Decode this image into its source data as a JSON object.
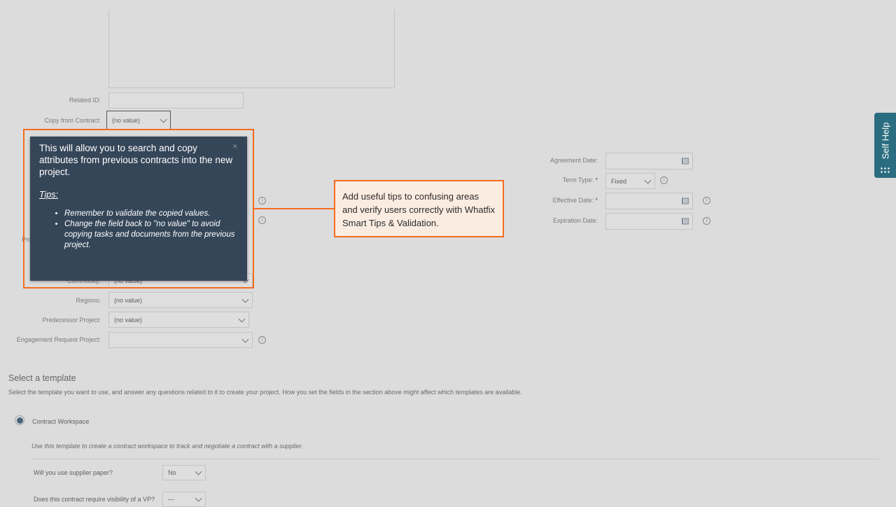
{
  "form": {
    "related_id_label": "Related ID:",
    "copy_label": "Copy from Contract:",
    "copy_value": "(no value)",
    "proj_label_partial": "Pro",
    "commodity_label": "Commodity:",
    "commodity_value": "(no value)",
    "regions_label": "Regions:",
    "regions_value": "(no value)",
    "predecessor_label": "Predecessor Project:",
    "predecessor_value": "(no value)",
    "engagement_label": "Engagement Request Project:",
    "engagement_value": ""
  },
  "right_form": {
    "agreement_label": "Agreement Date:",
    "term_label": "Term Type:",
    "term_value": "Fixed",
    "effective_label": "Effective Date:",
    "expiration_label": "Expiration Date:",
    "required_mark": "*"
  },
  "template": {
    "heading": "Select a template",
    "description": "Select the template you want to use, and answer any questions related to it to create your project. How you set the fields in the section above might affect which templates are available.",
    "option_label": "Contract Workspace",
    "option_desc": "Use this template to create a contract workspace to track and negotiate a contract with a supplier.",
    "q1_label": "Will you use supplier paper?",
    "q1_value": "No",
    "q2_label": "Does this contract require visibility of a VP?",
    "q2_value": "---"
  },
  "tooltip": {
    "main": "This will allow you to search and copy attributes from previous contracts into the new project.",
    "tips_heading": "Tips:",
    "tips": [
      "Remember to validate the copied values.",
      "Change the field back to \"no value\" to avoid copying tasks and documents from the previous project."
    ]
  },
  "callout": {
    "text": "Add useful tips to confusing areas and verify users correctly with Whatfix Smart Tips & Validation."
  },
  "self_help": {
    "label": "Self Help"
  },
  "colors": {
    "highlight": "#f36d1f",
    "tooltip_bg": "#354659",
    "self_help_bg": "#2b6d80"
  }
}
